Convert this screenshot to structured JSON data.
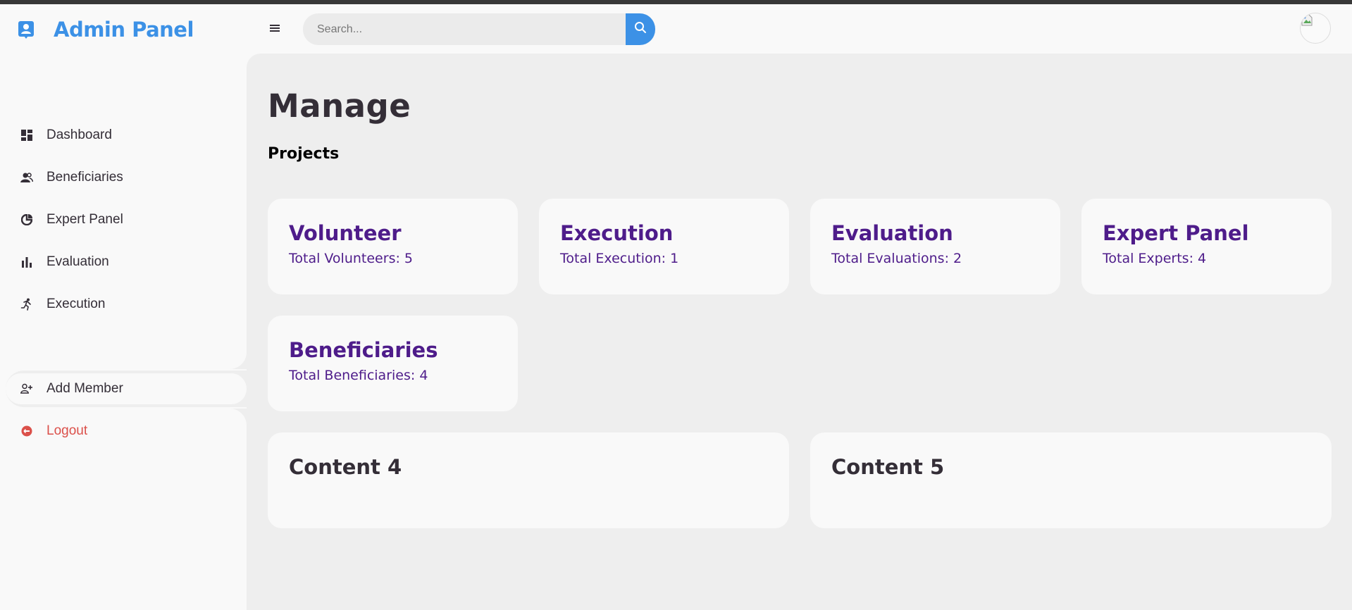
{
  "app": {
    "title": "Admin Panel",
    "brand_icon": "user-badge-icon",
    "accent": "#3c91e6"
  },
  "header": {
    "menu_icon": "hamburger-icon",
    "search": {
      "placeholder": "Search...",
      "value": ""
    },
    "search_icon": "search-icon",
    "avatar_icon": "broken-image-icon"
  },
  "sidebar": {
    "items": [
      {
        "label": "Dashboard",
        "icon": "dashboard-icon"
      },
      {
        "label": "Beneficiaries",
        "icon": "users-icon"
      },
      {
        "label": "Expert Panel",
        "icon": "pie-chart-icon"
      },
      {
        "label": "Evaluation",
        "icon": "bar-chart-icon"
      },
      {
        "label": "Execution",
        "icon": "running-icon"
      }
    ],
    "bottom": [
      {
        "label": "Add Member",
        "icon": "user-plus-icon",
        "active": true
      },
      {
        "label": "Logout",
        "icon": "logout-icon",
        "color": "#db504a"
      }
    ]
  },
  "main": {
    "title": "Manage",
    "breadcrumb": "Projects",
    "cards": [
      {
        "title": "Volunteer",
        "subtitle": "Total Volunteers: 5"
      },
      {
        "title": "Execution",
        "subtitle": "Total Execution: 1"
      },
      {
        "title": "Evaluation",
        "subtitle": "Total Evaluations: 2"
      },
      {
        "title": "Expert Panel",
        "subtitle": "Total Experts: 4"
      },
      {
        "title": "Beneficiaries",
        "subtitle": "Total Beneficiaries: 4"
      }
    ],
    "card_color": "#4e1c8a",
    "content_blocks": [
      {
        "title": "Content 4"
      },
      {
        "title": "Content 5"
      }
    ]
  }
}
